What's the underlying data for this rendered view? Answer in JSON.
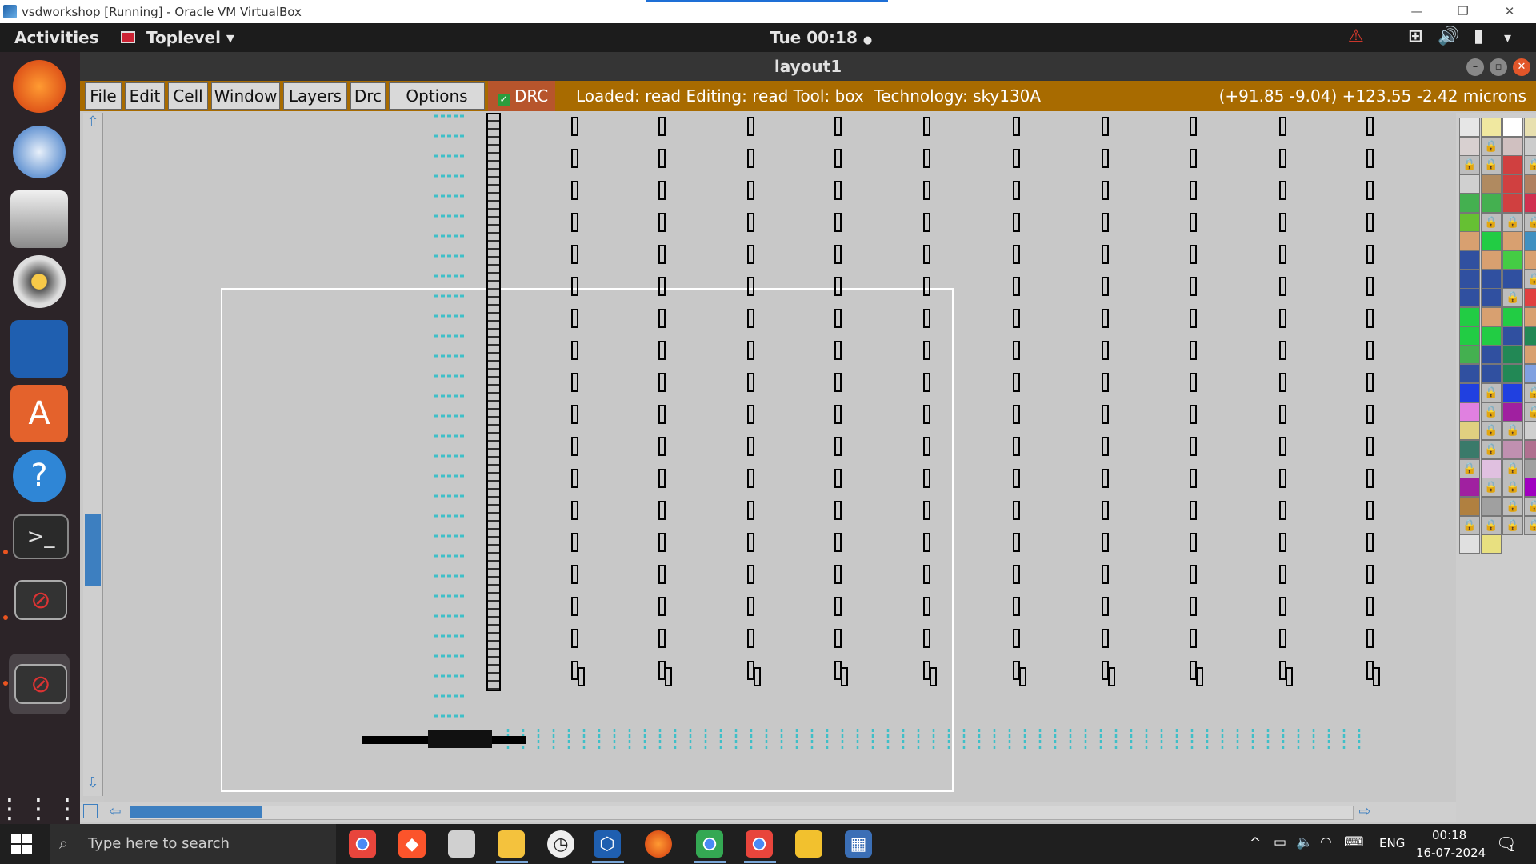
{
  "host": {
    "title": "vsdworkshop [Running] - Oracle VM VirtualBox",
    "minimize": "—",
    "restore": "❐",
    "close": "✕"
  },
  "gnome": {
    "activities": "Activities",
    "app_menu": "Toplevel",
    "app_menu_arrow": "▾",
    "clock": "Tue 00:18",
    "clock_dot": "●"
  },
  "magic": {
    "window_title": "layout1",
    "menu": [
      "File",
      "Edit",
      "Cell",
      "Window",
      "Layers",
      "Drc",
      "Options"
    ],
    "drc_label": "DRC",
    "drc_checked": true,
    "status": "Loaded: read Editing: read Tool: box  Technology: sky130A",
    "coords": "(+91.85 -9.04) +123.55 -2.42 microns"
  },
  "taskbar": {
    "search_placeholder": "Type here to search",
    "lang": "ENG",
    "time": "00:18",
    "date": "16-07-2024",
    "notification_count": "1"
  },
  "colors": {
    "magic_menu_bg": "#a86b00",
    "drc_bg": "#b7552c",
    "canvas_bg": "#c8c8c8",
    "cyan_layer": "#3fbfc8",
    "scroll_accent": "#3d7fc0"
  }
}
